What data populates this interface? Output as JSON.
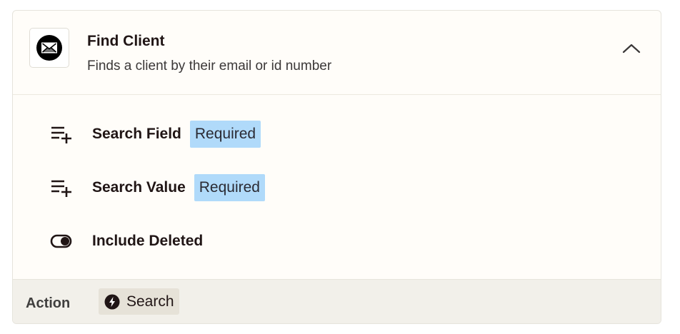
{
  "step": {
    "title": "Find Client",
    "description": "Finds a client by their email or id number",
    "app_icon": "envelope-logo-icon",
    "collapse_icon": "chevron-up-icon"
  },
  "fields": [
    {
      "label": "Search Field",
      "badge": "Required",
      "icon": "add-field-icon"
    },
    {
      "label": "Search Value",
      "badge": "Required",
      "icon": "add-field-icon"
    },
    {
      "label": "Include Deleted",
      "icon": "toggle-icon"
    }
  ],
  "footer": {
    "label": "Action",
    "action_label": "Search",
    "action_icon": "bolt-icon"
  },
  "colors": {
    "badge_bg": "#b0dafa",
    "footer_bg": "#f2f0ea",
    "chip_bg": "#e6e2d8",
    "card_bg": "#fffdf9"
  }
}
